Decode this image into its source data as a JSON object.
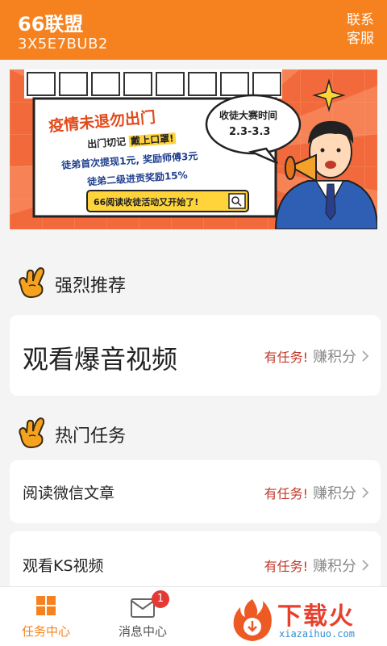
{
  "header": {
    "title": "66联盟",
    "code": "3X5E7BUB2",
    "contact_line1": "联系",
    "contact_line2": "客服"
  },
  "banner": {
    "headline": "疫情未退勿出门",
    "line_a_prefix": "出门切记",
    "line_a_highlight": "戴上口罩!",
    "line_b": "徒弟首次提现1元, 奖励师傅3元",
    "line_c": "徒弟二级进贡奖励15%",
    "cta": "66阅读收徒活动又开始了!",
    "bubble_title": "收徒大赛时间",
    "bubble_date": "2.3-3.3"
  },
  "sections": {
    "recommend_title": "强烈推荐",
    "hot_title": "热门任务"
  },
  "recommend_card": {
    "name": "观看爆音视频",
    "task": "有任务!",
    "earn": "赚积分"
  },
  "hot_tasks": [
    {
      "name": "阅读微信文章",
      "task": "有任务!",
      "earn": "赚积分"
    },
    {
      "name": "观看KS视频",
      "task": "有任务!",
      "earn": "赚积分"
    }
  ],
  "tabbar": {
    "tab1": "任务中心",
    "tab2": "消息中心",
    "badge": "1"
  },
  "watermark": {
    "text": "下载火",
    "url": "xiazaihuo.com"
  },
  "colors": {
    "brand": "#f5821f",
    "task_red": "#c0392b",
    "tab_active": "#f5821f",
    "tab_inactive": "#555555"
  }
}
